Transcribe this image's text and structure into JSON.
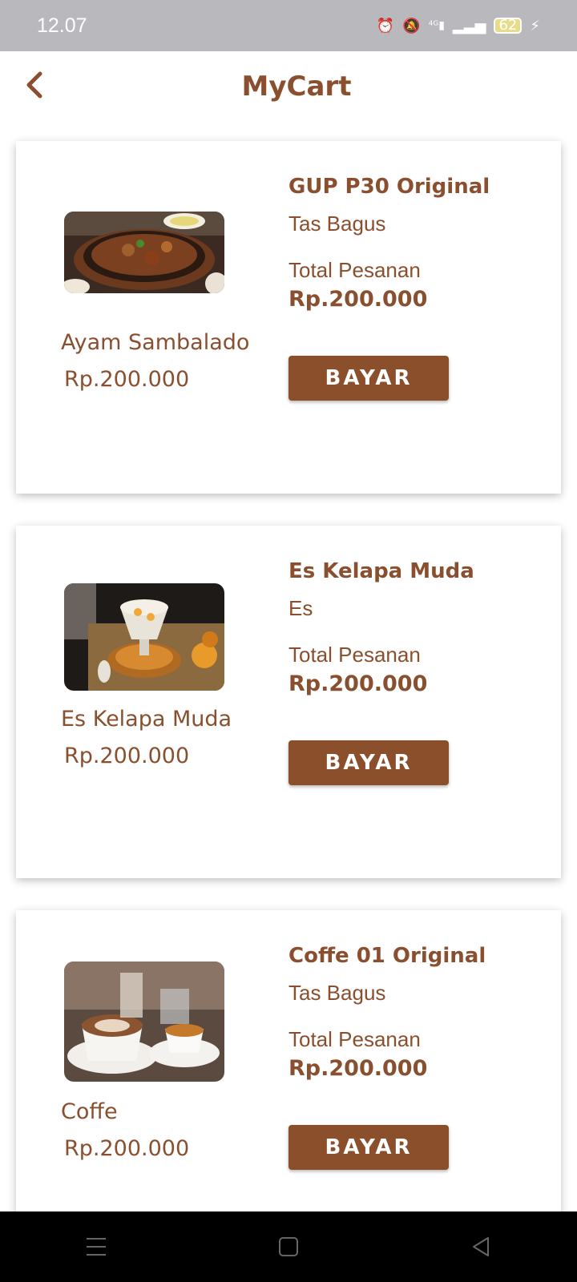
{
  "status_bar": {
    "time": "12.07",
    "battery": "62",
    "icons": [
      "alarm-icon",
      "mute-icon",
      "4g-signal-icon",
      "signal-icon",
      "battery-icon",
      "charging-icon"
    ]
  },
  "header": {
    "title": "MyCart",
    "back_icon": "chevron-left-icon"
  },
  "cart": {
    "items": [
      {
        "name": "Ayam Sambalado",
        "price": "Rp.200.000",
        "title": "GUP P30 Original",
        "subtitle": "Tas Bagus",
        "total_label": "Total Pesanan",
        "total_value": "Rp.200.000",
        "pay_label": "BAYAR"
      },
      {
        "name": "Es Kelapa Muda",
        "price": "Rp.200.000",
        "title": "Es Kelapa Muda",
        "subtitle": "Es",
        "total_label": "Total Pesanan",
        "total_value": "Rp.200.000",
        "pay_label": "BAYAR"
      },
      {
        "name": "Coffe",
        "price": "Rp.200.000",
        "title": "Coffe 01 Original",
        "subtitle": "Tas Bagus",
        "total_label": "Total Pesanan",
        "total_value": "Rp.200.000",
        "pay_label": "BAYAR"
      }
    ]
  },
  "colors": {
    "accent": "#8b4f2c",
    "text": "#8a4f2e",
    "status_bar": "#b9b8bd"
  },
  "nav_bar": {
    "icons": [
      "menu-icon",
      "home-square-icon",
      "back-triangle-icon"
    ]
  }
}
